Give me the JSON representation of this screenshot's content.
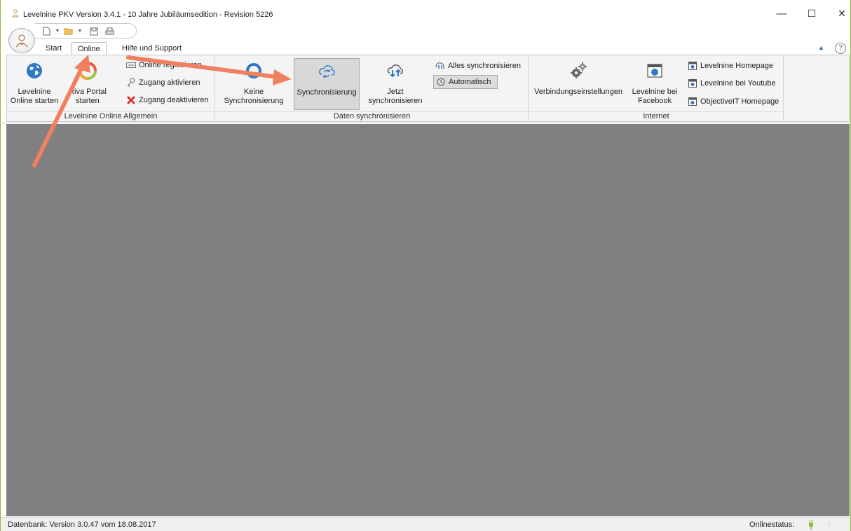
{
  "window": {
    "title": "Levelnine PKV Version 3.4.1 - 10 Jahre Jubiläumsedition -  Revision 5226",
    "minimize_glyph": "—",
    "maximize_glyph": "☐",
    "close_glyph": "✕"
  },
  "quick_access": {
    "items": [
      "new-document-icon",
      "open-folder-icon",
      "save-icon",
      "print-icon"
    ]
  },
  "tabs": [
    {
      "label": "Start",
      "active": false
    },
    {
      "label": "Online",
      "active": true
    },
    {
      "label": "Hilfe und Support",
      "active": false
    }
  ],
  "ribbon": {
    "groups": [
      {
        "label": "Levelnine Online Allgemein",
        "buttons": [
          {
            "label_line1": "Levelnine",
            "label_line2": "Online starten",
            "icon": "globe-icon"
          },
          {
            "label_line1": "Riva Portal",
            "label_line2": "starten",
            "icon": "riva-ring-icon"
          }
        ],
        "small_buttons": [
          {
            "label": "Online registrieren",
            "icon": "keyboard-icon"
          },
          {
            "label": "Zugang aktivieren",
            "icon": "key-icon"
          },
          {
            "label": "Zugang deaktivieren",
            "icon": "red-x-icon"
          }
        ]
      },
      {
        "label": "Daten synchronisieren",
        "buttons": [
          {
            "label_line1": "Keine",
            "label_line2": "Synchronisierung",
            "icon": "no-sync-icon"
          },
          {
            "label_line1": "Synchronisierung",
            "label_line2": "",
            "icon": "cloud-sync-icon",
            "pressed": true
          },
          {
            "label_line1": "Jetzt",
            "label_line2": "synchronisieren",
            "icon": "cloud-arrows-icon"
          }
        ],
        "small_buttons": [
          {
            "label": "Alles synchronisieren",
            "icon": "sync-all-icon"
          },
          {
            "label": "Automatisch",
            "icon": "clock-icon",
            "pressed": true
          }
        ]
      },
      {
        "label": "Internet",
        "buttons": [
          {
            "label_line1": "Verbindungseinstellungen",
            "label_line2": "",
            "icon": "gears-icon"
          },
          {
            "label_line1": "Levelnine bei",
            "label_line2": "Facebook",
            "icon": "browser-globe-icon"
          }
        ],
        "small_buttons": [
          {
            "label": "Levelnine Homepage",
            "icon": "browser-icon"
          },
          {
            "label": "Levelnine bei Youtube",
            "icon": "browser-icon"
          },
          {
            "label": "ObjectiveIT Homepage",
            "icon": "browser-icon"
          }
        ]
      }
    ]
  },
  "statusbar": {
    "database": "Datenbank: Version 3.0.47 vom 18.08.2017",
    "online_label": "Onlinestatus:"
  },
  "colors": {
    "workspace": "#808080",
    "ribbon": "#f4f4f4",
    "arrow": "#f08060",
    "accent_green": "#8fbc3a"
  }
}
